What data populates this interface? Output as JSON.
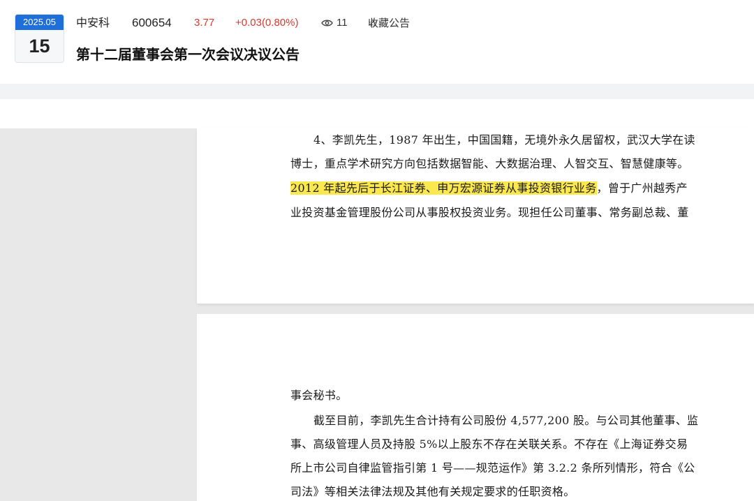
{
  "header": {
    "date_month": "2025.05",
    "date_day": "15",
    "stock_name": "中安科",
    "stock_code": "600654",
    "price": "3.77",
    "change": "+0.03(0.80%)",
    "views": "11",
    "favorite_label": "收藏公告",
    "title": "第十二届董事会第一次会议决议公告"
  },
  "document": {
    "page1": {
      "lines": [
        "4、李凯先生，1987 年出生，中国国籍，无境外永久居留权，武汉大学在读",
        "博士，重点学术研究方向包括数据智能、大数据治理、人智交互、智慧健康等。",
        "2012 年起先后于长江证券、申万宏源证券从事投资银行业务",
        "，曾于广州越秀产",
        "业投资基金管理股份公司从事股权投资业务。现担任公司董事、常务副总裁、董"
      ]
    },
    "page2": {
      "lines": [
        "事会秘书。",
        "截至目前，李凯先生合计持有公司股份 4,577,200 股。与公司其他董事、监",
        "事、高级管理人员及持股 5%以上股东不存在关联关系。不存在《上海证券交易",
        "所上市公司自律监管指引第 1 号——规范运作》第 3.2.2 条所列情形，符合《公",
        "司法》等相关法律法规及其他有关规定要求的任职资格。"
      ]
    }
  },
  "colors": {
    "accent": "#1e6fd9",
    "up": "#e0372e",
    "highlight": "#fbe74e"
  },
  "icons": {
    "views": "eye-icon",
    "favorite": "star-outline-icon"
  }
}
